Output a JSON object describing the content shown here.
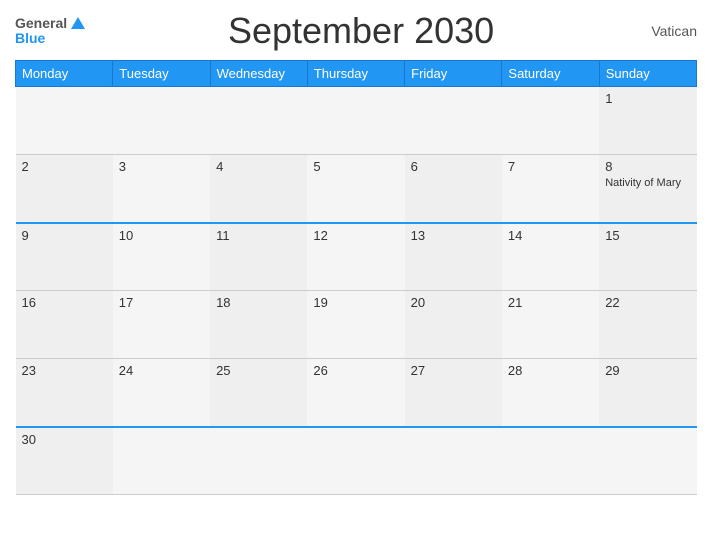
{
  "header": {
    "logo_general": "General",
    "logo_blue": "Blue",
    "title": "September 2030",
    "region": "Vatican"
  },
  "days_header": [
    "Monday",
    "Tuesday",
    "Wednesday",
    "Thursday",
    "Friday",
    "Saturday",
    "Sunday"
  ],
  "weeks": [
    {
      "row_blue_top": false,
      "days": [
        {
          "number": "",
          "event": ""
        },
        {
          "number": "",
          "event": ""
        },
        {
          "number": "",
          "event": ""
        },
        {
          "number": "",
          "event": ""
        },
        {
          "number": "",
          "event": ""
        },
        {
          "number": "",
          "event": ""
        },
        {
          "number": "1",
          "event": ""
        }
      ]
    },
    {
      "row_blue_top": false,
      "days": [
        {
          "number": "2",
          "event": ""
        },
        {
          "number": "3",
          "event": ""
        },
        {
          "number": "4",
          "event": ""
        },
        {
          "number": "5",
          "event": ""
        },
        {
          "number": "6",
          "event": ""
        },
        {
          "number": "7",
          "event": ""
        },
        {
          "number": "8",
          "event": "Nativity of Mary"
        }
      ]
    },
    {
      "row_blue_top": true,
      "days": [
        {
          "number": "9",
          "event": ""
        },
        {
          "number": "10",
          "event": ""
        },
        {
          "number": "11",
          "event": ""
        },
        {
          "number": "12",
          "event": ""
        },
        {
          "number": "13",
          "event": ""
        },
        {
          "number": "14",
          "event": ""
        },
        {
          "number": "15",
          "event": ""
        }
      ]
    },
    {
      "row_blue_top": false,
      "days": [
        {
          "number": "16",
          "event": ""
        },
        {
          "number": "17",
          "event": ""
        },
        {
          "number": "18",
          "event": ""
        },
        {
          "number": "19",
          "event": ""
        },
        {
          "number": "20",
          "event": ""
        },
        {
          "number": "21",
          "event": ""
        },
        {
          "number": "22",
          "event": ""
        }
      ]
    },
    {
      "row_blue_top": false,
      "days": [
        {
          "number": "23",
          "event": ""
        },
        {
          "number": "24",
          "event": ""
        },
        {
          "number": "25",
          "event": ""
        },
        {
          "number": "26",
          "event": ""
        },
        {
          "number": "27",
          "event": ""
        },
        {
          "number": "28",
          "event": ""
        },
        {
          "number": "29",
          "event": ""
        }
      ]
    },
    {
      "row_blue_top": true,
      "days": [
        {
          "number": "30",
          "event": ""
        },
        {
          "number": "",
          "event": ""
        },
        {
          "number": "",
          "event": ""
        },
        {
          "number": "",
          "event": ""
        },
        {
          "number": "",
          "event": ""
        },
        {
          "number": "",
          "event": ""
        },
        {
          "number": "",
          "event": ""
        }
      ]
    }
  ]
}
